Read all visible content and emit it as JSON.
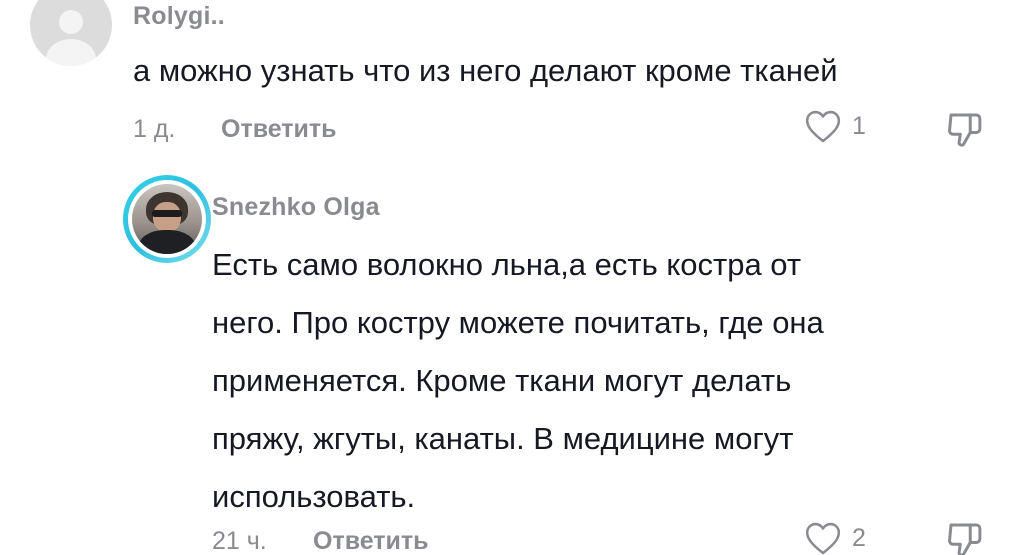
{
  "comment": {
    "username": "Rolygi..",
    "text": "а можно узнать что из него делают кроме тканей",
    "time": "1 д.",
    "reply_label": "Ответить",
    "likes": "1"
  },
  "reply": {
    "username": "Snezhko Olga",
    "text_lines": [
      "Есть само волокно льна,а есть костра от",
      "него. Про костру можете почитать, где она",
      "применяется. Кроме ткани могут делать",
      "пряжу, жгуты, канаты. В медицине могут",
      "использовать."
    ],
    "time": "21 ч.",
    "reply_label": "Ответить",
    "likes": "2"
  },
  "icons": {
    "like": "heart-outline-icon",
    "dislike": "thumbs-down-outline-icon"
  },
  "colors": {
    "text_primary": "#161823",
    "text_secondary": "#8a8b91",
    "avatar_ring": "#35d0e6"
  }
}
